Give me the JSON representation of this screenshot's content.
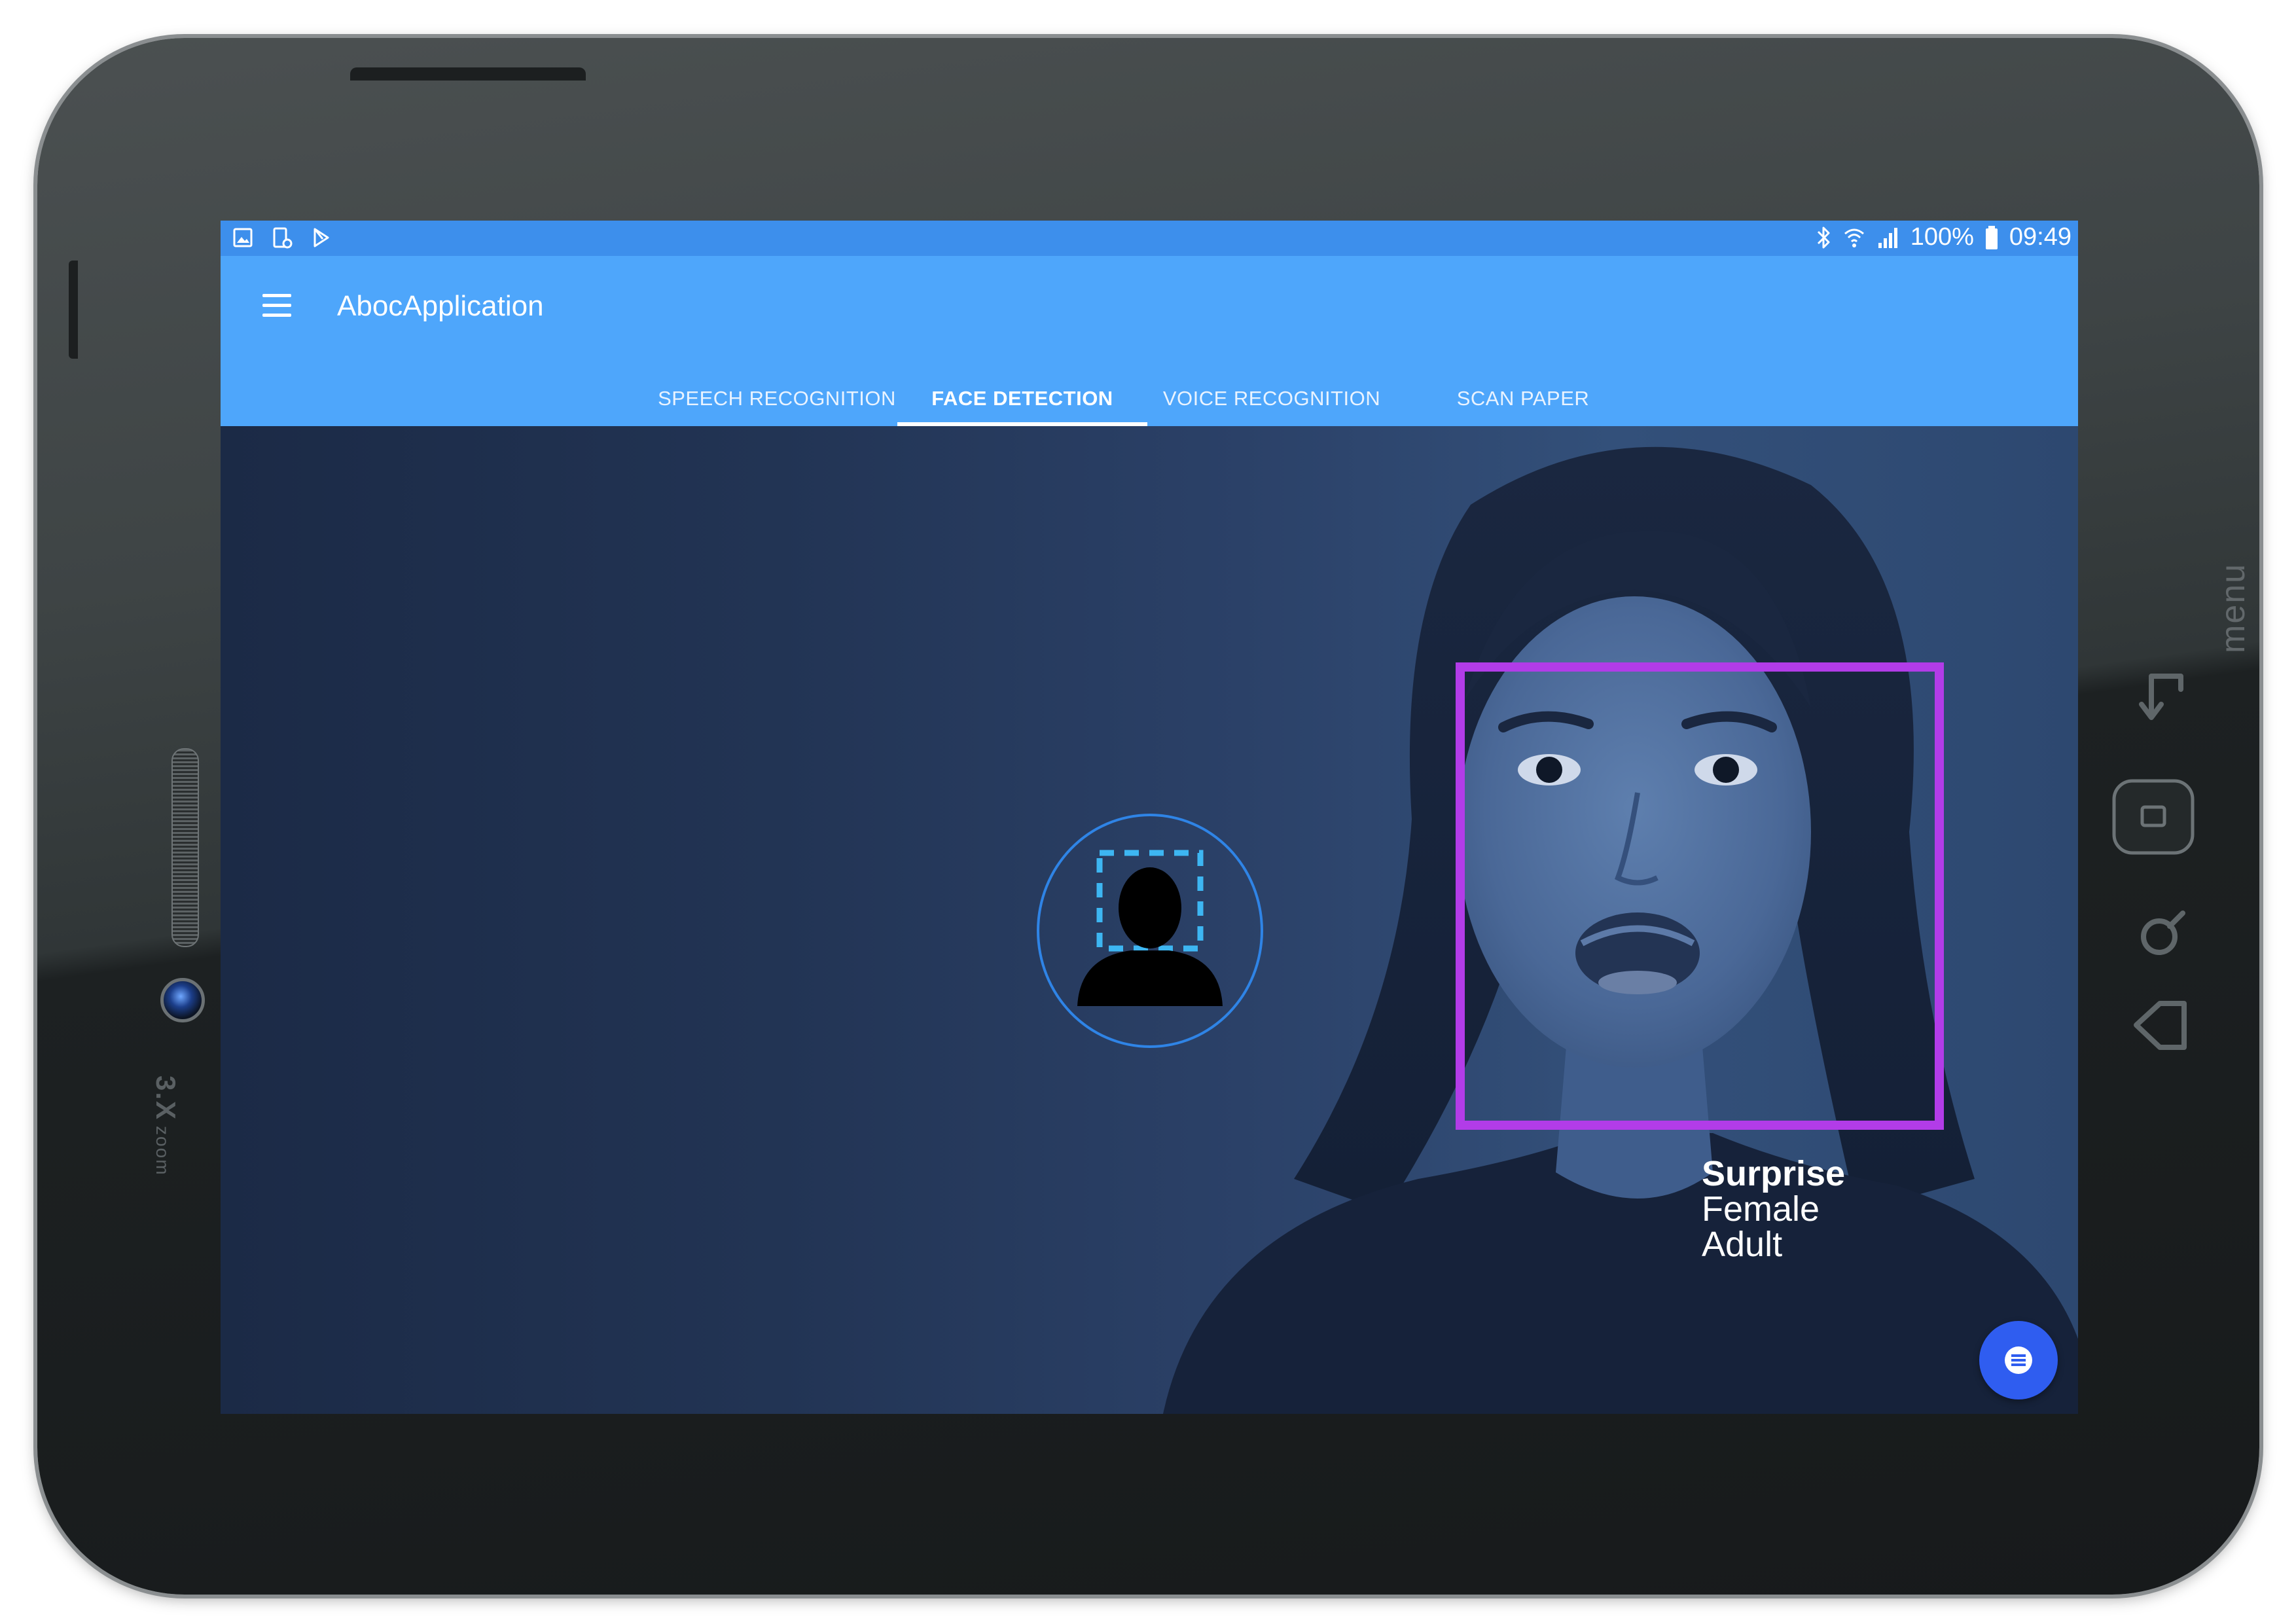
{
  "device": {
    "zoom_badge": "3.X",
    "zoom_word": "zoom",
    "hardware_menu_label": "menu"
  },
  "status_bar": {
    "left_icons": [
      "gallery-icon",
      "device-settings-icon",
      "play-store-icon"
    ],
    "right_icons": [
      "bluetooth-icon",
      "wifi-icon",
      "signal-icon",
      "battery-icon"
    ],
    "battery": "100%",
    "time": "09:49"
  },
  "app_bar": {
    "title": "AbocApplication",
    "menu_icon": "hamburger-menu-icon"
  },
  "tabs": [
    {
      "label": "SPEECH RECOGNITION",
      "active": false
    },
    {
      "label": "FACE DETECTION",
      "active": true
    },
    {
      "label": "VOICE RECOGNITION",
      "active": false
    },
    {
      "label": "SCAN PAPER",
      "active": false
    }
  ],
  "detection": {
    "emotion": "Surprise",
    "gender": "Female",
    "age": "Adult",
    "box_color": "#b23ce8"
  },
  "colors": {
    "status_bar": "#3d8fec",
    "app_bar": "#4ea6fb",
    "fab": "#2f5df0",
    "face_icon_ring": "#2f84e6"
  },
  "fab": {
    "icon": "list-icon"
  }
}
